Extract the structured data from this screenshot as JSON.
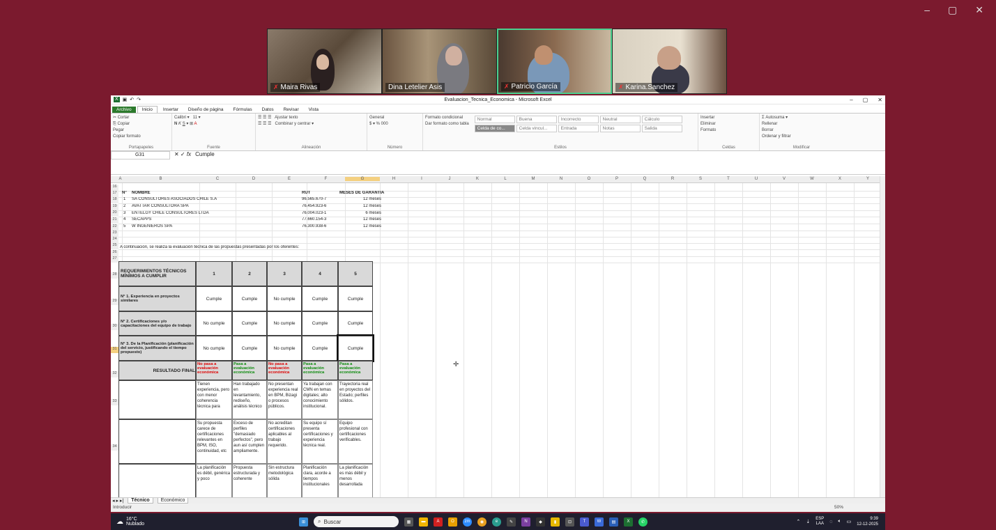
{
  "window_controls": {
    "minimize": "–",
    "restore": "▢",
    "close": "✕"
  },
  "participants": [
    {
      "name": "Maira Rivas",
      "muted": true
    },
    {
      "name": "Dina Letelier Asis",
      "muted": false
    },
    {
      "name": "Patricio García",
      "muted": true,
      "active": true
    },
    {
      "name": "Karina.Sanchez",
      "muted": true
    }
  ],
  "excel": {
    "title": "Evaluacion_Tecnica_Economica - Microsoft Excel",
    "tabs": [
      "Archivo",
      "Inicio",
      "Insertar",
      "Diseño de página",
      "Fórmulas",
      "Datos",
      "Revisar",
      "Vista"
    ],
    "ribbon": {
      "clipboard": {
        "cut": "Cortar",
        "copy": "Copiar",
        "paste": "Pegar",
        "format_painter": "Copiar formato",
        "name": "Portapapeles"
      },
      "font": {
        "family": "Calibri",
        "size": "11",
        "name": "Fuente"
      },
      "alignment": {
        "wrap": "Ajustar texto",
        "merge": "Combinar y centrar",
        "name": "Alineación"
      },
      "number": {
        "format": "General",
        "name": "Número"
      },
      "styles": {
        "cond": "Formato condicional",
        "table": "Dar formato como tabla",
        "boxes": [
          "Normal",
          "Buena",
          "Incorrecto",
          "Neutral",
          "Cálculo",
          "Celda de co...",
          "Celda vincul...",
          "Entrada",
          "Notas",
          "Salida"
        ],
        "name": "Estilos"
      },
      "cells": {
        "insert": "Insertar",
        "delete": "Eliminar",
        "format": "Formato",
        "name": "Celdas"
      },
      "editing": {
        "autosum": "Autosuma",
        "fill": "Rellenar",
        "clear": "Borrar",
        "sort": "Ordenar y filtrar",
        "find": "Buscar y seleccionar",
        "name": "Modificar"
      }
    },
    "namebox": "G31",
    "formula": "Cumple",
    "columns": [
      "A",
      "B",
      "C",
      "D",
      "E",
      "F",
      "G",
      "H",
      "I",
      "J",
      "K",
      "L",
      "M",
      "N",
      "O",
      "P",
      "Q",
      "R",
      "S",
      "T",
      "U",
      "V",
      "W",
      "X",
      "Y",
      "Z"
    ],
    "rows_top": [
      "16",
      "17",
      "18",
      "19",
      "20",
      "21",
      "22",
      "23",
      "24",
      "25",
      "26",
      "27"
    ],
    "rows_table": [
      "28",
      "29",
      "30",
      "31",
      "32",
      "33",
      "34"
    ],
    "company_header": {
      "n": "N°",
      "name": "NOMBRE",
      "rut": "RUT",
      "warranty": "MESES DE GARANTÍA"
    },
    "companies": [
      {
        "n": "1",
        "name": "SA CONSULTORES ASOCIADOS CHILE S.A",
        "rut": "96.565.670-7",
        "warranty": "12 meses"
      },
      {
        "n": "2",
        "name": "AVATTAR CONSULTORA SPA",
        "rut": "76.454.923-6",
        "warranty": "12 meses"
      },
      {
        "n": "3",
        "name": "ENTELGY CHILE CONSULTORES LTDA",
        "rut": "76.004.023-1",
        "warranty": "6 meses"
      },
      {
        "n": "4",
        "name": "SECAPPS",
        "rut": "77.660.154-3",
        "warranty": "12 meses"
      },
      {
        "n": "5",
        "name": "W INGENIEROS SPA",
        "rut": "76.300.938-6",
        "warranty": "12 meses"
      }
    ],
    "intro": "A continuación, se realiza la evaluación técnica de las propuestas presentadas por los oferentes:",
    "req_header": "REQUERIMIENTOS TÉCNICOS MÍNIMOS A CUMPLIR",
    "offer_cols": [
      "1",
      "2",
      "3",
      "4",
      "5"
    ],
    "requirements": [
      {
        "label": "N° 1. Experiencia en proyectos similares",
        "vals": [
          "Cumple",
          "Cumple",
          "No cumple",
          "Cumple",
          "Cumple"
        ]
      },
      {
        "label": "N° 2. Certificaciones y/o capacitaciones del equipo de trabajo",
        "vals": [
          "No cumple",
          "Cumple",
          "No cumple",
          "Cumple",
          "Cumple"
        ]
      },
      {
        "label": "N° 3. De la Planificación (planificación del servicio, justificando el tiempo propuesto)",
        "vals": [
          "No cumple",
          "Cumple",
          "No cumple",
          "Cumple",
          "Cumple"
        ]
      }
    ],
    "final_label": "RESULTADO FINAL",
    "final": [
      {
        "text": "No pasa a evaluación económica",
        "ok": false
      },
      {
        "text": "Pasa a evaluación económica",
        "ok": true
      },
      {
        "text": "No pasa a evaluación económica",
        "ok": false
      },
      {
        "text": "Pasa a evaluación económica",
        "ok": true
      },
      {
        "text": "Pasa a evaluación económica",
        "ok": true
      }
    ],
    "notes_row33": [
      "Tienen experiencia, pero con menor coherencia técnica para",
      "Han trabajado en levantamiento, rediseño, análisis técnico",
      "No presentan experiencia real en BPM, Bizagi o procesos públicos.",
      "Ya trabajan con CMN en temas digitales; alto conocimiento institucional.",
      "Trayectoria real en proyectos del Estado; perfiles sólidos."
    ],
    "notes_row34": [
      "Su propuesta carece de certificaciones relevantes en BPM, ISO, continuidad, etc",
      "Exceso de perfiles \"demasiado perfectos\", pero aun así cumplen ampliamente.",
      "No acreditan certificaciones aplicables al trabajo requerido.",
      "Su equipo sí presenta certificaciones y experiencia técnica real.",
      "Equipo profesional con certificaciones verificables."
    ],
    "notes_row35": [
      "La planificación es débil, genérica y poco",
      "Propuesta estructurada y coherente",
      "Sin estructura metodológica sólida",
      "Planificación clara, acorde a tiempos institucionales",
      "La planificación es más débil y menos desarrollada"
    ],
    "sheets": [
      "Técnico",
      "Económico"
    ],
    "status": "Introducir",
    "zoom": "50%"
  },
  "taskbar": {
    "temp": "16°C",
    "weather": "Nublado",
    "search": "Buscar",
    "lang_top": "ESP",
    "lang_bottom": "LAA",
    "time": "9:39",
    "date": "12-12-2025"
  }
}
